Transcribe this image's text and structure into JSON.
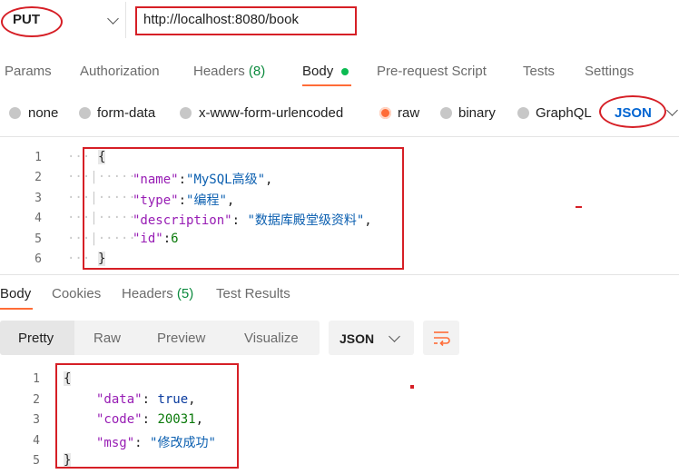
{
  "request": {
    "method": "PUT",
    "url": "http://localhost:8080/book"
  },
  "request_tabs": [
    {
      "label": "Params"
    },
    {
      "label": "Authorization"
    },
    {
      "label": "Headers",
      "count": "(8)"
    },
    {
      "label": "Body"
    },
    {
      "label": "Pre-request Script"
    },
    {
      "label": "Tests"
    },
    {
      "label": "Settings"
    }
  ],
  "body_types": [
    {
      "label": "none"
    },
    {
      "label": "form-data"
    },
    {
      "label": "x-www-form-urlencoded"
    },
    {
      "label": "raw"
    },
    {
      "label": "binary"
    },
    {
      "label": "GraphQL"
    }
  ],
  "body_format": "JSON",
  "request_body": {
    "line_numbers": [
      "1",
      "2",
      "3",
      "4",
      "5",
      "6"
    ],
    "open_brace": "{",
    "close_brace": "}",
    "fields": [
      {
        "key": "\"name\"",
        "sep": ":",
        "value": "\"MySQL高级\"",
        "tail": ","
      },
      {
        "key": "\"type\"",
        "sep": ":",
        "value": "\"编程\"",
        "tail": ","
      },
      {
        "key": "\"description\"",
        "sep": ": ",
        "value": "\"数据库殿堂级资料\"",
        "tail": ","
      },
      {
        "key": "\"id\"",
        "sep": ":",
        "value": "6",
        "tail": ""
      }
    ]
  },
  "response_tabs": [
    {
      "label": "Body"
    },
    {
      "label": "Cookies"
    },
    {
      "label": "Headers",
      "count": "(5)"
    },
    {
      "label": "Test Results"
    }
  ],
  "view_modes": [
    {
      "label": "Pretty"
    },
    {
      "label": "Raw"
    },
    {
      "label": "Preview"
    },
    {
      "label": "Visualize"
    }
  ],
  "response_format": "JSON",
  "response_body": {
    "line_numbers": [
      "1",
      "2",
      "3",
      "4",
      "5"
    ],
    "open_brace": "{",
    "close_brace": "}",
    "fields": [
      {
        "key": "\"data\"",
        "sep": ": ",
        "value": "true",
        "tail": ","
      },
      {
        "key": "\"code\"",
        "sep": ": ",
        "value": "20031",
        "tail": ","
      },
      {
        "key": "\"msg\"",
        "sep": ": ",
        "value": "\"修改成功\"",
        "tail": ""
      }
    ]
  },
  "colors": {
    "accent": "#ff6c37",
    "annotation_red": "#d61f26",
    "json_blue": "#0265d2",
    "count_green": "#0c8a3e"
  }
}
